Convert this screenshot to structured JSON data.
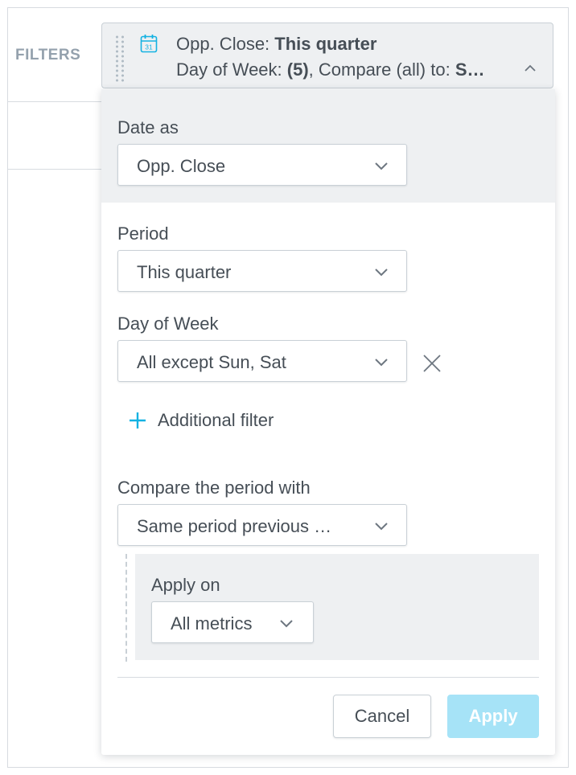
{
  "filters_label": "FILTERS",
  "chip": {
    "line1_prefix": "Opp. Close: ",
    "line1_value": "This quarter",
    "line2_day_label": "Day of Week: ",
    "line2_day_count": "(5)",
    "line2_compare_label": ", Compare (all) to: ",
    "line2_compare_value": "S…",
    "calendar_day": "31",
    "icon": "calendar-icon",
    "caret_icon": "chevron-up-icon",
    "accent_color": "#14b2e2"
  },
  "date_as": {
    "label": "Date as",
    "value": "Opp. Close"
  },
  "period": {
    "label": "Period",
    "value": "This quarter"
  },
  "day_of_week": {
    "label": "Day of Week",
    "value": "All except Sun, Sat",
    "remove_icon": "close-icon"
  },
  "additional_filter": {
    "label": "Additional filter",
    "icon": "plus-icon"
  },
  "compare": {
    "label": "Compare the period with",
    "value": "Same period previous …"
  },
  "apply_on": {
    "label": "Apply on",
    "value": "All metrics"
  },
  "buttons": {
    "cancel": "Cancel",
    "apply": "Apply",
    "apply_color": "#a6e3f7"
  }
}
